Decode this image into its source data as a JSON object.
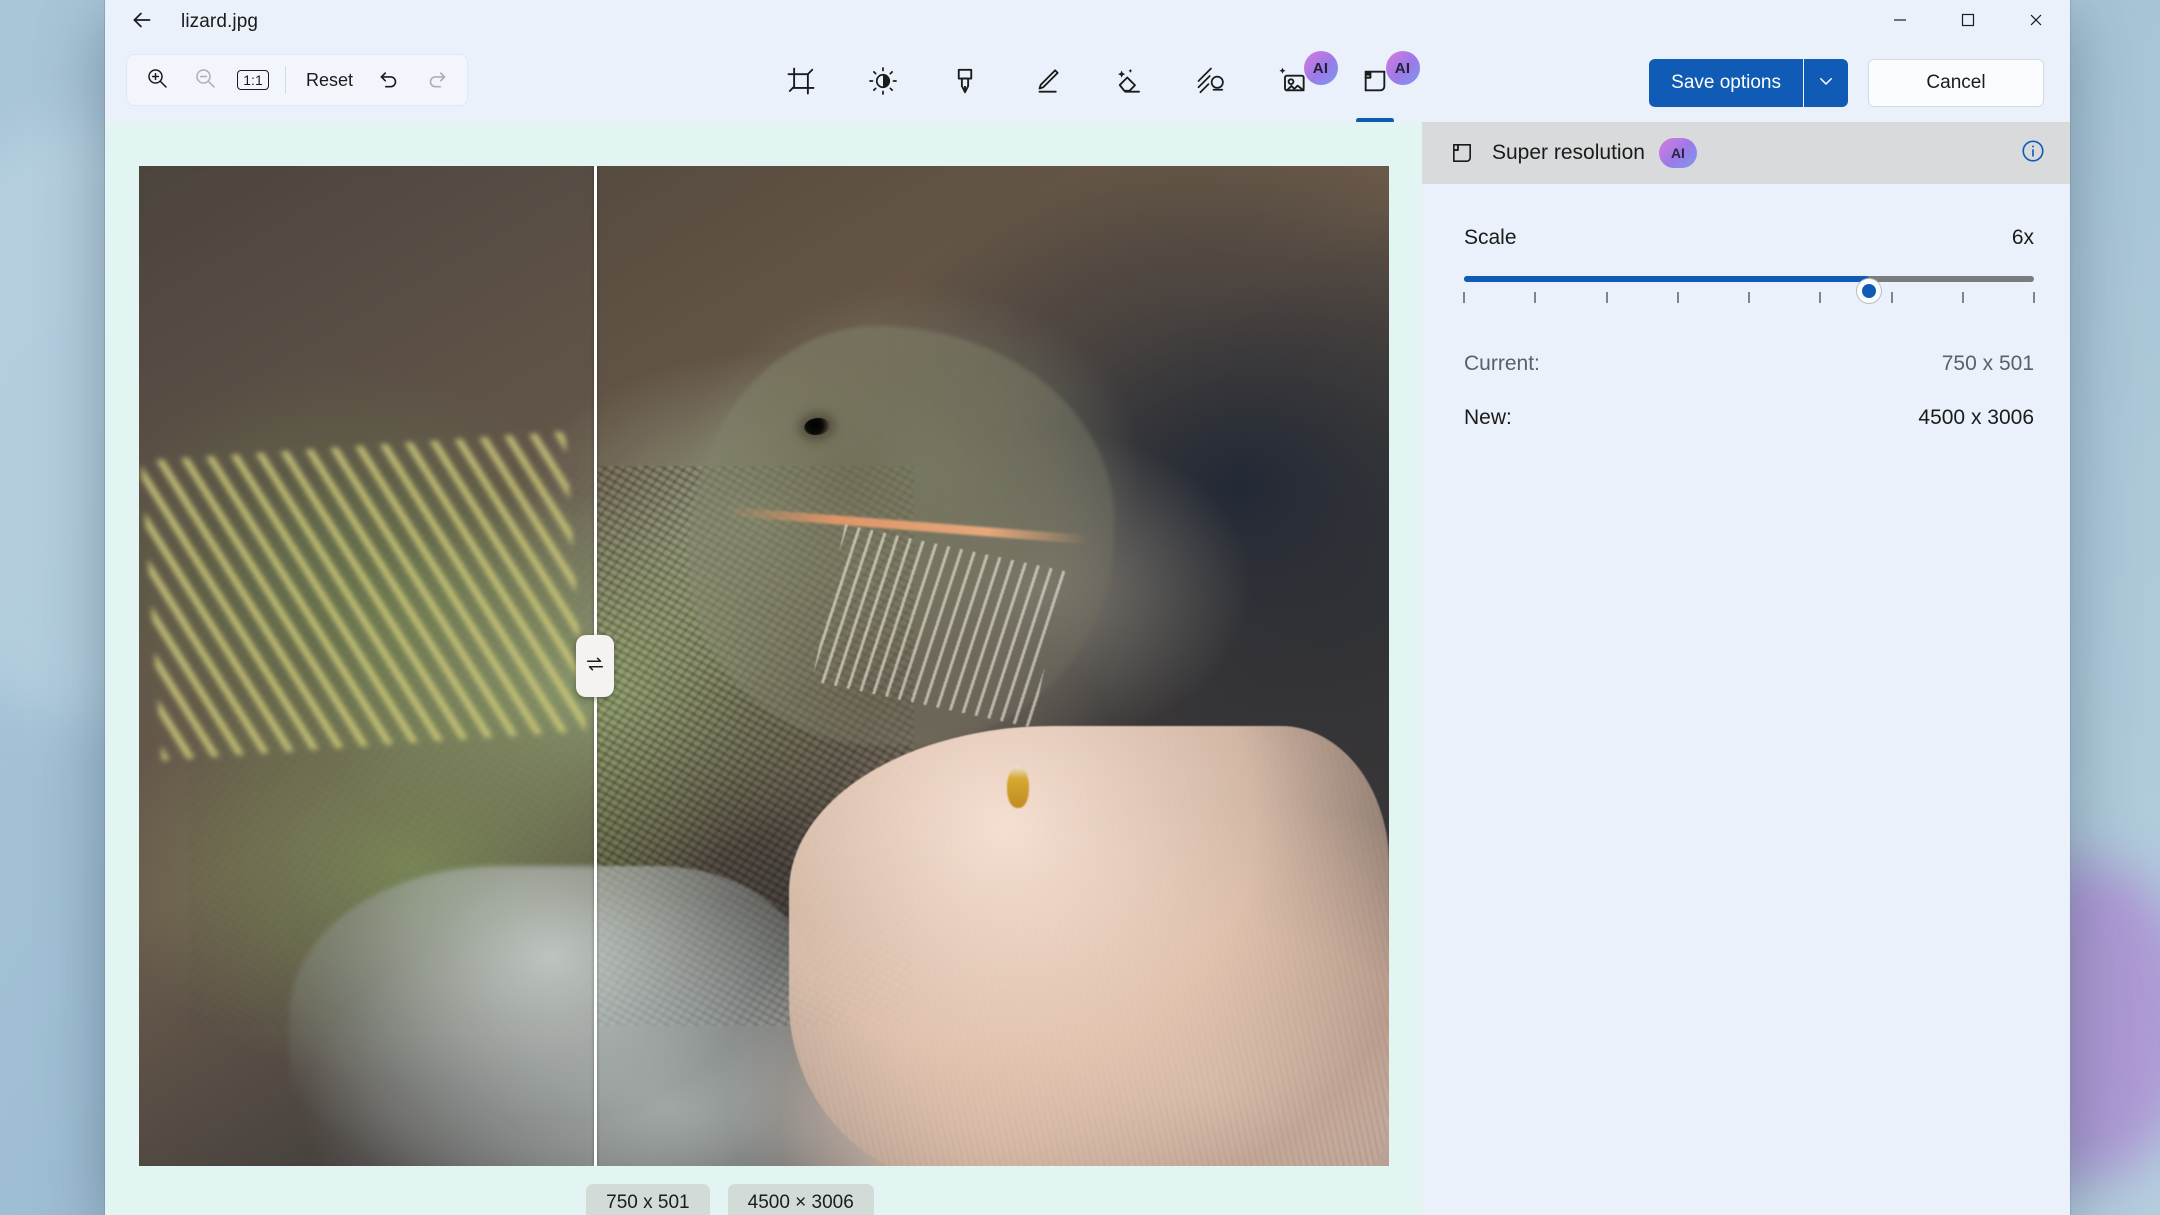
{
  "window": {
    "title": "lizard.jpg",
    "back_icon": "back-arrow-icon",
    "controls": {
      "minimize": "minimize-icon",
      "maximize": "maximize-icon",
      "close": "close-icon"
    }
  },
  "toolbar": {
    "zoom_in": "zoom-in-icon",
    "zoom_out": "zoom-out-icon",
    "actual_size_label": "1:1",
    "reset_label": "Reset",
    "undo": "undo-icon",
    "redo": "redo-icon",
    "tools": [
      {
        "name": "crop",
        "icon": "crop-icon",
        "ai": false,
        "active": false
      },
      {
        "name": "adjust-brightness",
        "icon": "brightness-icon",
        "ai": false,
        "active": false
      },
      {
        "name": "markup-highlighter",
        "icon": "highlighter-icon",
        "ai": false,
        "active": false
      },
      {
        "name": "draw-pen",
        "icon": "pen-icon",
        "ai": false,
        "active": false
      },
      {
        "name": "magic-eraser",
        "icon": "magic-eraser-icon",
        "ai": false,
        "active": false
      },
      {
        "name": "blur",
        "icon": "blur-icon",
        "ai": false,
        "active": false
      },
      {
        "name": "background-remover",
        "icon": "background-remover-icon",
        "ai": true,
        "badge": "AI",
        "active": false
      },
      {
        "name": "super-resolution",
        "icon": "super-resolution-icon",
        "ai": true,
        "badge": "AI",
        "active": true
      }
    ],
    "save_options_label": "Save options",
    "save_options_chevron": "chevron-down-icon",
    "cancel_label": "Cancel"
  },
  "canvas": {
    "compare_handle_icon": "swap-arrows-icon",
    "before_chip": "750 x 501",
    "after_chip": "4500 × 3006"
  },
  "panel": {
    "header_icon": "super-resolution-icon",
    "title": "Super resolution",
    "ai_badge": "AI",
    "info_icon": "info-icon",
    "scale_label": "Scale",
    "scale_value": "6x",
    "slider": {
      "min": 2,
      "max": 10,
      "value": 6,
      "fill_percent": 71,
      "tick_count": 9
    },
    "current_label": "Current:",
    "current_value": "750 x 501",
    "new_label": "New:",
    "new_value": "4500 x 3006"
  },
  "colors": {
    "accent": "#0f5bb5",
    "window_bg": "#eaf1fa",
    "panel_header_bg": "#d9dadb",
    "canvas_bg": "#e3f5f2",
    "ai_badge_gradient_start": "#d77bdd",
    "ai_badge_gradient_end": "#7c9af0"
  }
}
